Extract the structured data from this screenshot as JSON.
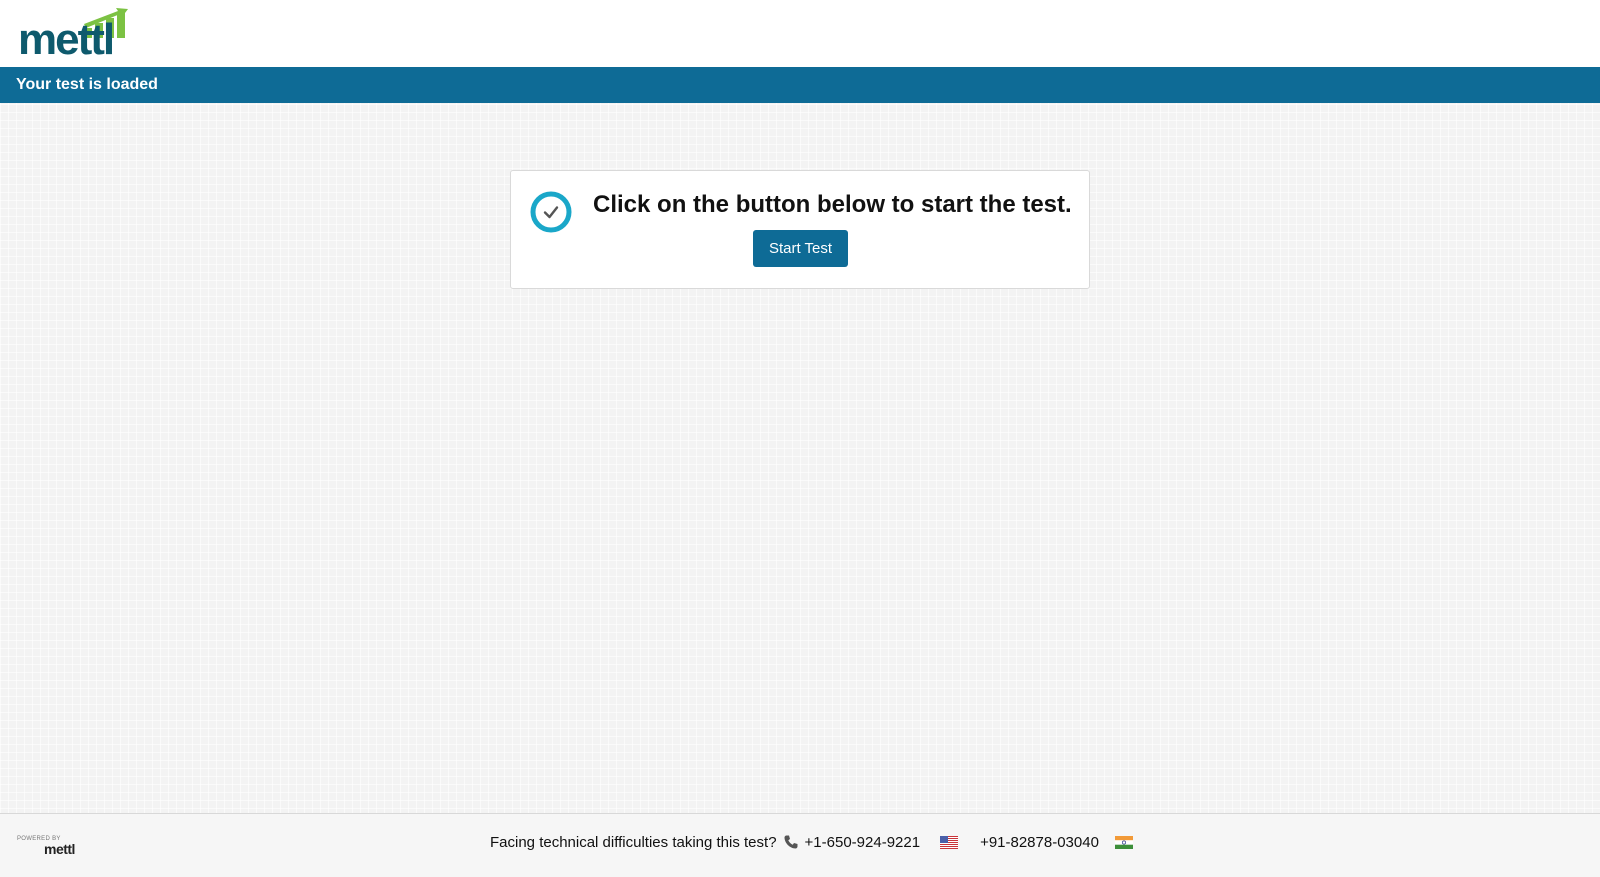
{
  "header": {
    "logo_text": "mettl",
    "logo_icon": "bar-chart-logo-icon"
  },
  "title_bar": {
    "text": "Your test is loaded"
  },
  "card": {
    "icon": "check-circle-icon",
    "message": "Click on the button below to start the test.",
    "start_button_label": "Start Test"
  },
  "footer": {
    "powered_by_label": "POWERED BY",
    "powered_by_logo": "mettl",
    "support_text": "Facing technical difficulties taking this test?",
    "phone_icon": "phone-icon",
    "us_phone": "+1-650-924-9221",
    "us_flag_icon": "us-flag-icon",
    "india_phone": "+91-82878-03040",
    "india_flag_icon": "india-flag-icon"
  },
  "colors": {
    "brand_blue": "#0e6b96",
    "logo_teal": "#0e5a6d",
    "logo_green": "#7cc243",
    "check_ring": "#1aa7c9"
  }
}
